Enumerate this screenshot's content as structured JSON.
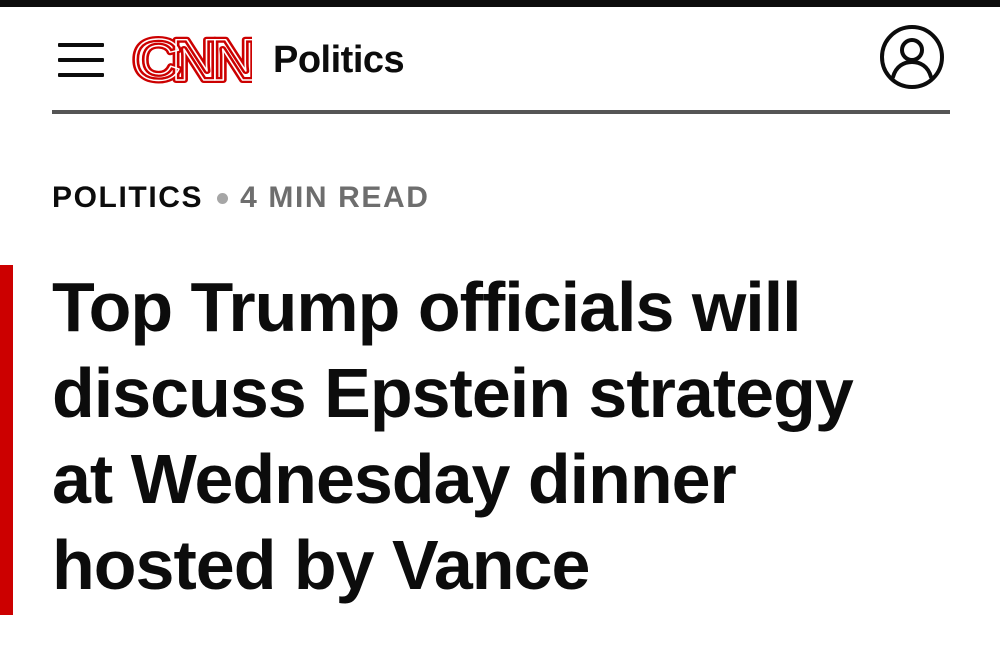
{
  "header": {
    "logo_text": "CNN",
    "section_title": "Politics",
    "icons": {
      "menu": "hamburger-menu-icon",
      "account": "user-account-icon"
    }
  },
  "article": {
    "category": "POLITICS",
    "read_time": "4 MIN READ",
    "headline_lines": [
      "Top Trump officials will",
      "discuss Epstein strategy",
      "at Wednesday dinner",
      "hosted by Vance"
    ]
  },
  "colors": {
    "brand_red": "#cc0000",
    "text": "#0c0c0c",
    "muted": "#6e6e6e",
    "rule": "#555555"
  }
}
